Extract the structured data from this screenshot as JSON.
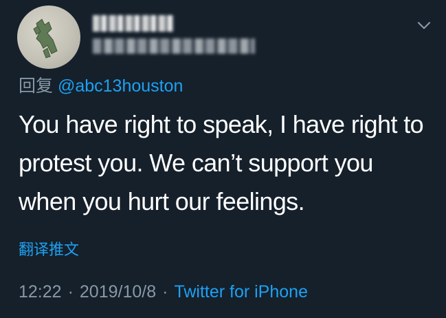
{
  "tweet": {
    "reply_prefix": "回复",
    "reply_to": "@abc13houston",
    "text": "You have right to speak, I have right to\nprotest you. We can’t support  you\nwhen you hurt our feelings.",
    "translate_label": "翻译推文",
    "time": "12:22",
    "separator": "·",
    "date": "2019/10/8",
    "source": "Twitter for iPhone"
  },
  "icons": {
    "avatar": "avatar",
    "menu": "chevron-down-icon"
  },
  "colors": {
    "background": "#15202b",
    "accent": "#1da1f2",
    "secondary_text": "#8899a6",
    "primary_text": "#ffffff"
  }
}
